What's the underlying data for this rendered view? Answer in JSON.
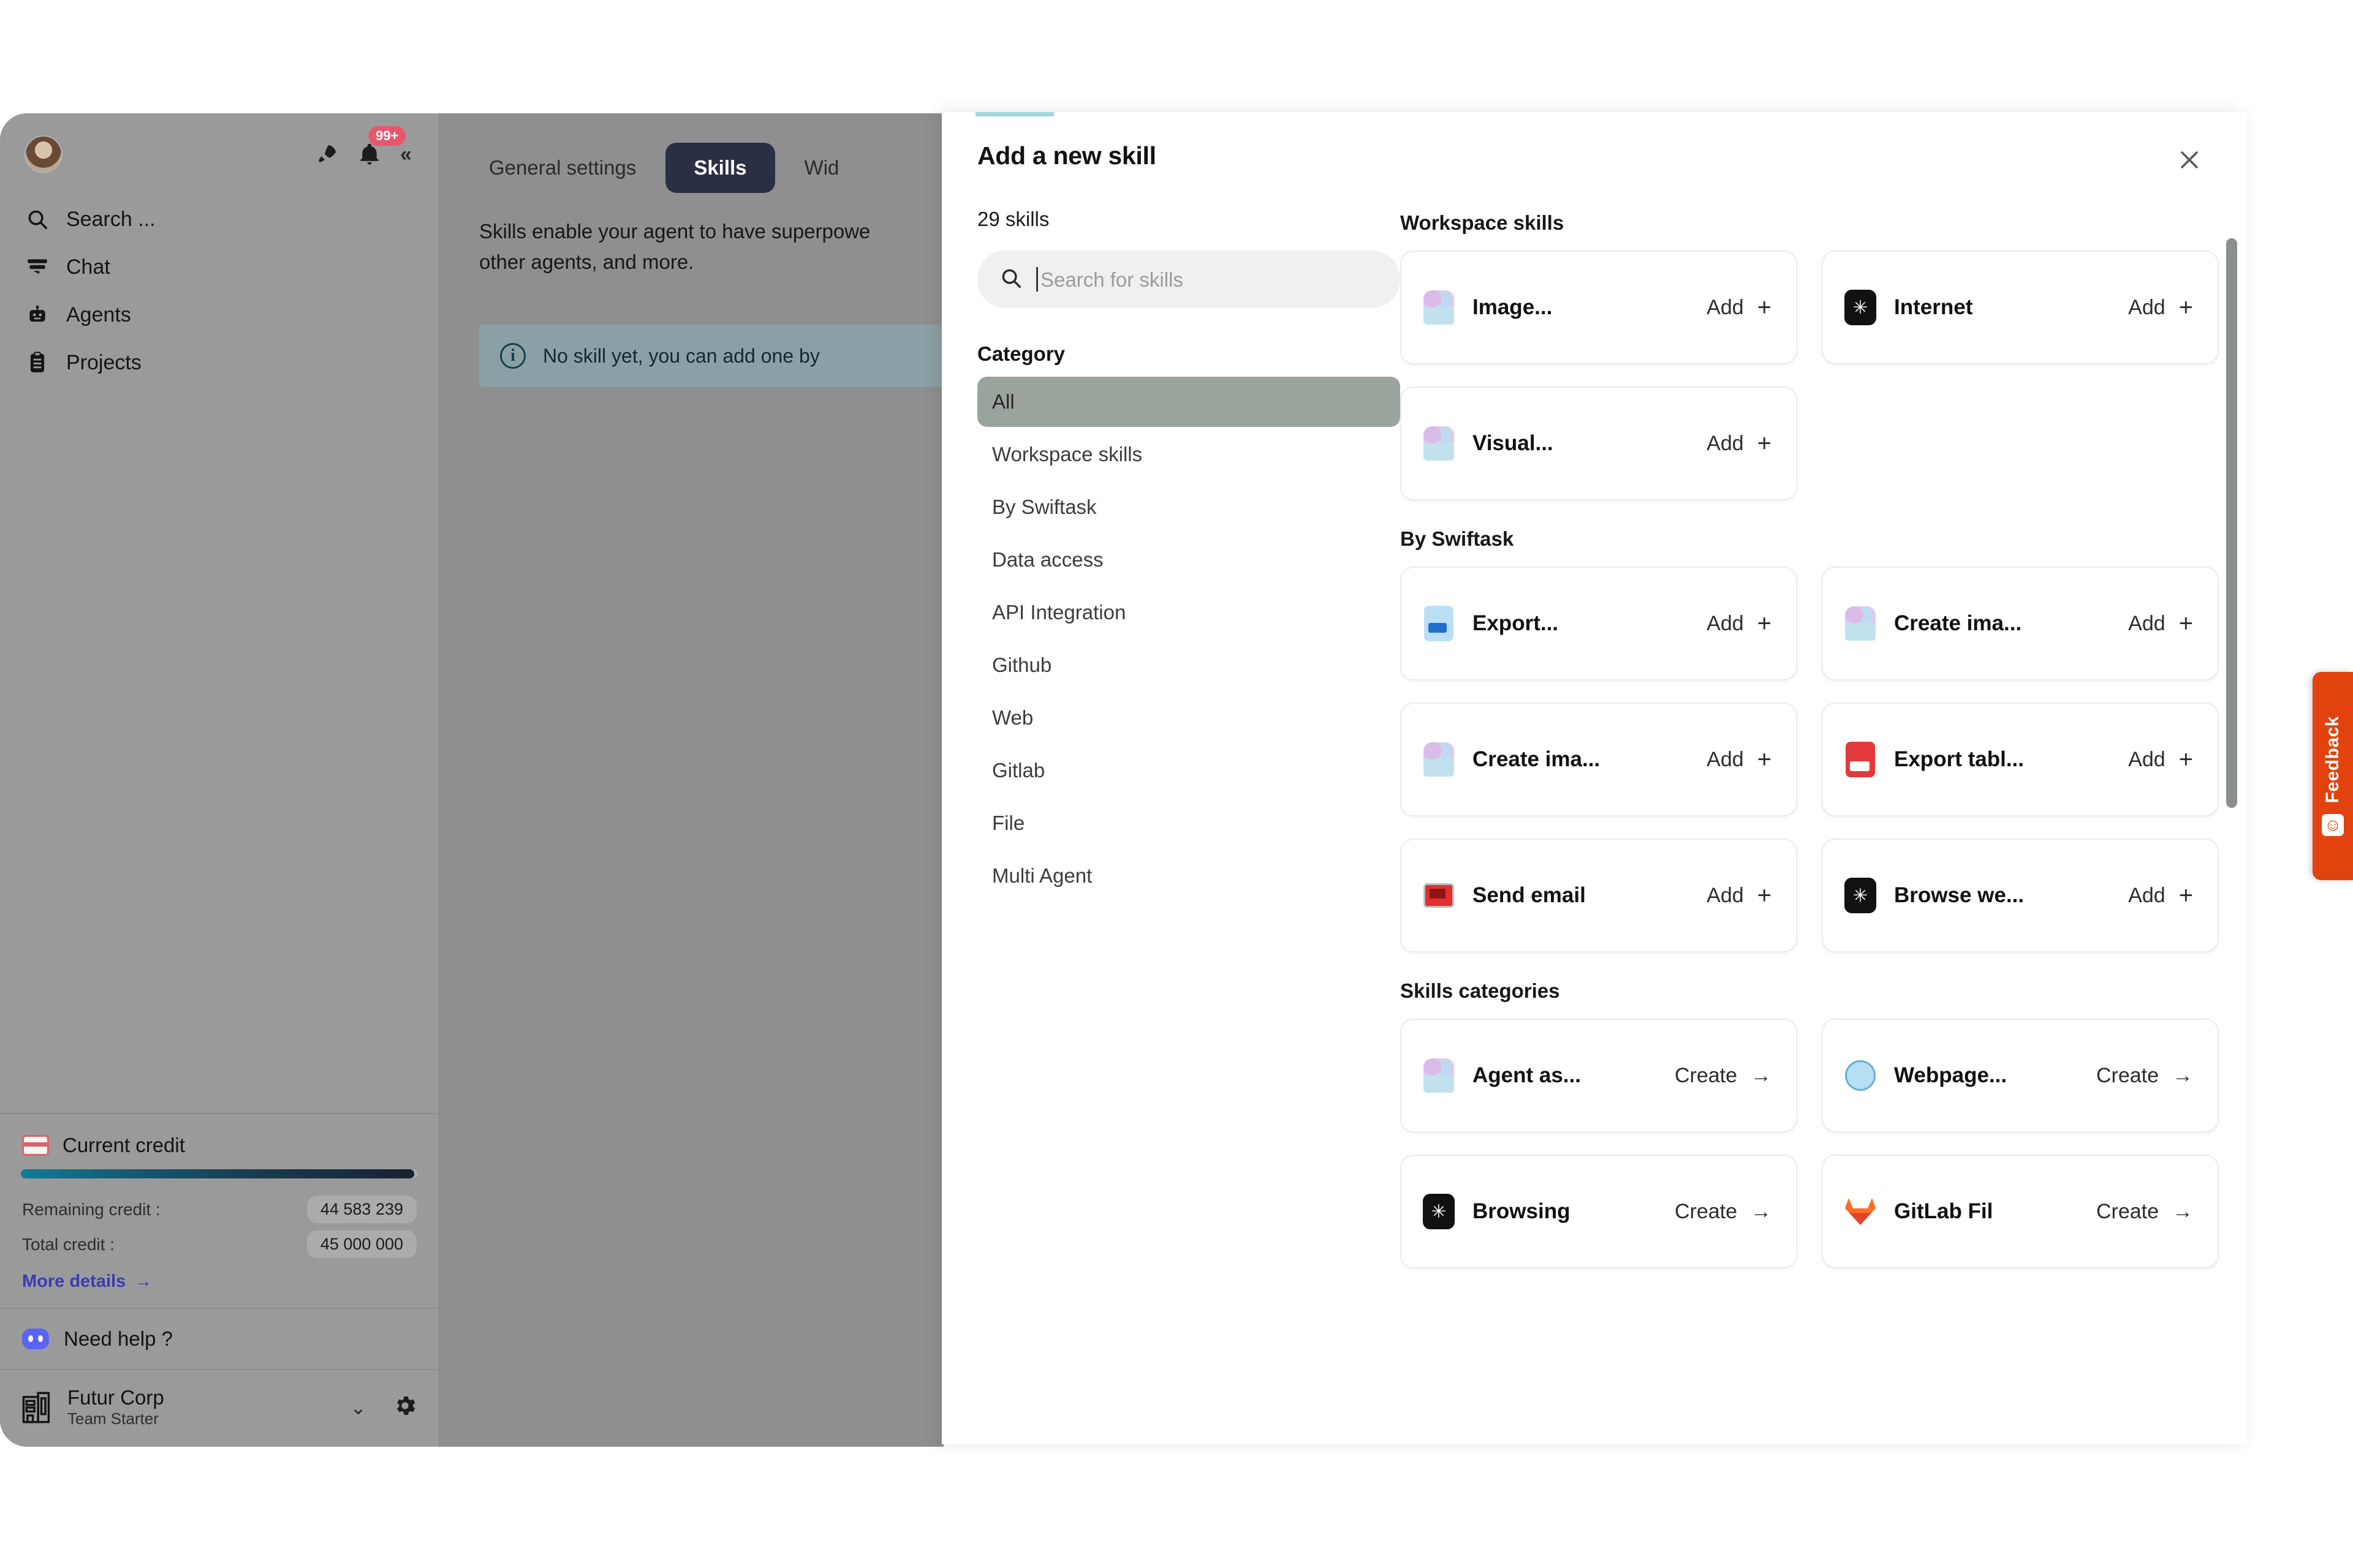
{
  "sidebar": {
    "notification_badge": "99+",
    "collapse_glyph": "«",
    "search_label": "Search ...",
    "nav_items": [
      {
        "label": "Chat",
        "icon": "chat-icon"
      },
      {
        "label": "Agents",
        "icon": "robot-icon"
      },
      {
        "label": "Projects",
        "icon": "clipboard-icon"
      }
    ],
    "credit": {
      "title": "Current credit",
      "remaining_label": "Remaining credit :",
      "remaining_value": "44 583 239",
      "total_label": "Total credit :",
      "total_value": "45 000 000",
      "more_details": "More details",
      "more_details_arrow": "→",
      "progress_percent": 99,
      "bar_start_color": "#0e7d96",
      "bar_end_color": "#1a2030"
    },
    "help": {
      "label": "Need help ?",
      "icon": "discord-icon"
    },
    "workspace": {
      "name": "Futur Corp",
      "plan": "Team Starter",
      "caret": "⌄",
      "gear_icon": "gear-icon"
    }
  },
  "main": {
    "tabs": [
      {
        "label": "General settings",
        "active": false
      },
      {
        "label": "Skills",
        "active": true
      },
      {
        "label": "Wid",
        "active": false
      }
    ],
    "description": "Skills enable your agent to have superpowe other agents, and more.",
    "info_notice": "No skill yet, you can add one by",
    "info_icon": "info-icon"
  },
  "modal": {
    "title": "Add a new skill",
    "close_icon": "close-icon",
    "skills_count": "29 skills",
    "search": {
      "value": "",
      "placeholder": "Search for skills",
      "icon": "search-icon"
    },
    "category_title": "Category",
    "categories": [
      {
        "label": "All",
        "selected": true
      },
      {
        "label": "Workspace skills",
        "selected": false
      },
      {
        "label": "By Swiftask",
        "selected": false
      },
      {
        "label": "Data access",
        "selected": false
      },
      {
        "label": "API Integration",
        "selected": false
      },
      {
        "label": "Github",
        "selected": false
      },
      {
        "label": "Web",
        "selected": false
      },
      {
        "label": "Gitlab",
        "selected": false
      },
      {
        "label": "File",
        "selected": false
      },
      {
        "label": "Multi Agent",
        "selected": false
      }
    ],
    "sections": [
      {
        "label": "Workspace skills",
        "cards": [
          {
            "name": "Image...",
            "action": "Add",
            "action_glyph": "+",
            "icon": "robot-icon"
          },
          {
            "name": "Internet",
            "action": "Add",
            "action_glyph": "+",
            "icon": "internet-icon"
          },
          {
            "name": "Visual...",
            "action": "Add",
            "action_glyph": "+",
            "icon": "robot-icon"
          }
        ]
      },
      {
        "label": "By Swiftask",
        "cards": [
          {
            "name": "Export...",
            "action": "Add",
            "action_glyph": "+",
            "icon": "word-doc-icon"
          },
          {
            "name": "Create ima...",
            "action": "Add",
            "action_glyph": "+",
            "icon": "robot-icon"
          },
          {
            "name": "Create ima...",
            "action": "Add",
            "action_glyph": "+",
            "icon": "robot-icon"
          },
          {
            "name": "Export tabl...",
            "action": "Add",
            "action_glyph": "+",
            "icon": "excel-doc-icon"
          },
          {
            "name": "Send email",
            "action": "Add",
            "action_glyph": "+",
            "icon": "mail-icon"
          },
          {
            "name": "Browse we...",
            "action": "Add",
            "action_glyph": "+",
            "icon": "internet-icon"
          }
        ]
      },
      {
        "label": "Skills categories",
        "cards": [
          {
            "name": "Agent as...",
            "action": "Create",
            "action_glyph": "→",
            "icon": "robot-icon"
          },
          {
            "name": "Webpage...",
            "action": "Create",
            "action_glyph": "→",
            "icon": "globe-icon"
          },
          {
            "name": "Browsing",
            "action": "Create",
            "action_glyph": "→",
            "icon": "internet-icon"
          },
          {
            "name": "GitLab Fil",
            "action": "Create",
            "action_glyph": "→",
            "icon": "gitlab-icon"
          }
        ]
      }
    ]
  },
  "feedback": {
    "label": "Feedback",
    "smiley": "☺",
    "color": "#e2420e"
  }
}
